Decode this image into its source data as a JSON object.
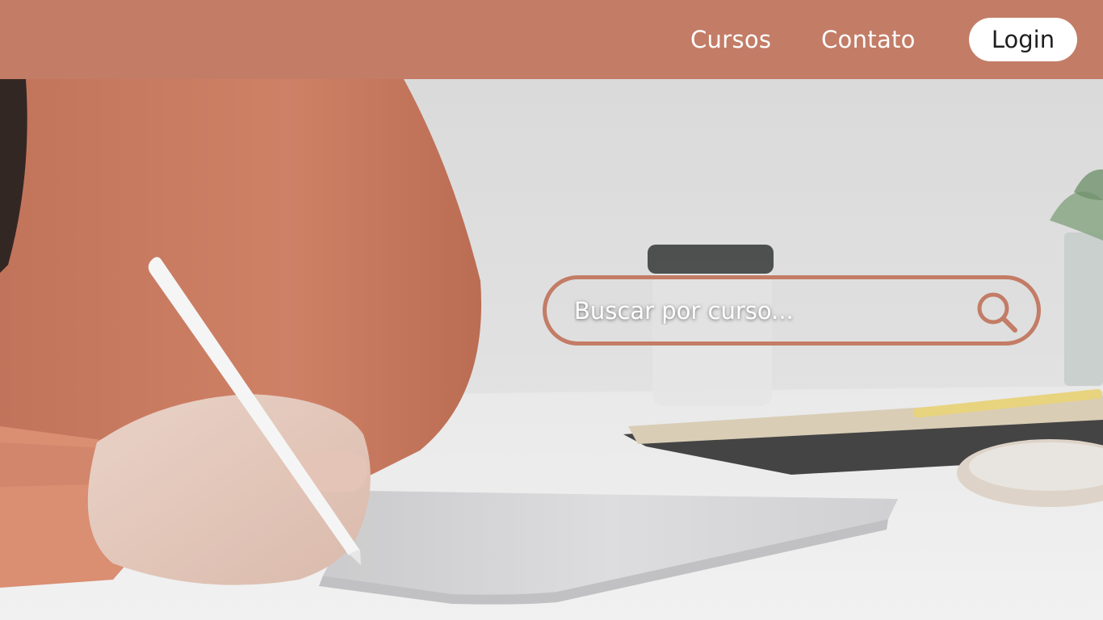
{
  "header": {
    "nav": [
      {
        "label": "Cursos"
      },
      {
        "label": "Contato"
      }
    ],
    "login_label": "Login"
  },
  "search": {
    "placeholder": "Buscar por curso...",
    "value": "",
    "icon": "search-icon"
  },
  "hero": {
    "image": "person-writing-on-tablet-photo"
  },
  "colors": {
    "brand": "#c37c66",
    "nav_text": "#ffffff",
    "login_bg": "#ffffff",
    "login_text": "#1f1f1f"
  }
}
